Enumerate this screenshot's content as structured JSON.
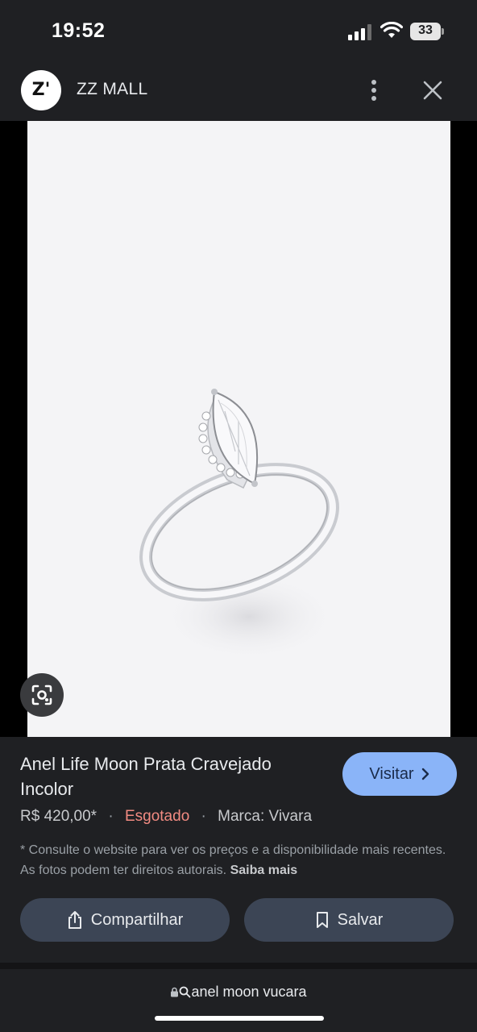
{
  "status_bar": {
    "time": "19:52",
    "battery": "33"
  },
  "header": {
    "logo_text": "Z'",
    "site_name": "ZZ MALL"
  },
  "product": {
    "title": "Anel Life Moon Prata Cravejado Incolor",
    "visit_label": "Visitar",
    "price": "R$ 420,00*",
    "separator": "·",
    "availability": "Esgotado",
    "brand": "Marca: Vivara",
    "disclaimer": "* Consulte o website para ver os preços e a disponibilidade mais recentes. As fotos podem ter direitos autorais.",
    "learn_more": "Saiba mais"
  },
  "actions": {
    "share_label": "Compartilhar",
    "save_label": "Salvar"
  },
  "url_bar": {
    "query": "anel moon vucara"
  },
  "colors": {
    "background": "#1f2023",
    "accent": "#8ab4f8",
    "soldout": "#f28b82",
    "button": "#3c4555"
  },
  "icons": [
    "signal-icon",
    "wifi-icon",
    "battery-icon",
    "more-vert-icon",
    "close-icon",
    "lens-icon",
    "chevron-right-icon",
    "share-icon",
    "bookmark-icon",
    "lock-icon",
    "search-icon"
  ]
}
